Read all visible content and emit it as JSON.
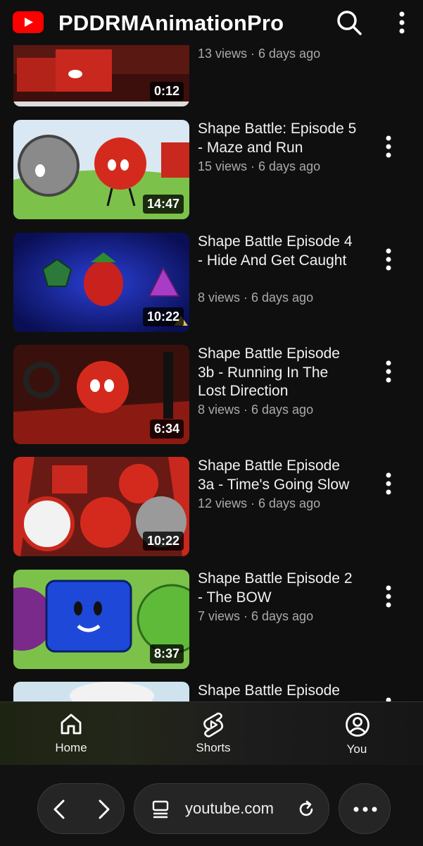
{
  "header": {
    "channel_name": "PDDRMAnimationPro",
    "logo_icon": "youtube-logo-icon",
    "search_icon": "search-icon",
    "menu_icon": "more-vertical-icon"
  },
  "videos": [
    {
      "title": "",
      "views": "13 views",
      "age": "6 days ago",
      "meta": "13 views · 6 days ago",
      "duration": "0:12"
    },
    {
      "title": "Shape Battle: Episode 5 - Maze and Run",
      "views": "15 views",
      "age": "6 days ago",
      "meta": "15 views · 6 days ago",
      "duration": "14:47"
    },
    {
      "title": "Shape Battle Episode 4 - Hide And Get Caught",
      "views": "8 views",
      "age": "6 days ago",
      "meta": "8 views · 6 days ago",
      "duration": "10:22"
    },
    {
      "title": "Shape Battle Episode 3b - Running In The Lost Direction",
      "views": "8 views",
      "age": "6 days ago",
      "meta": "8 views · 6 days ago",
      "duration": "6:34"
    },
    {
      "title": "Shape Battle Episode 3a - Time's Going Slow",
      "views": "12 views",
      "age": "6 days ago",
      "meta": "12 views · 6 days ago",
      "duration": "10:22"
    },
    {
      "title": "Shape Battle Episode 2 - The BOW",
      "views": "7 views",
      "age": "6 days ago",
      "meta": "7 views · 6 days ago",
      "duration": "8:37"
    },
    {
      "title": "Shape Battle Episode",
      "views": "",
      "age": "",
      "meta": "",
      "duration": ""
    }
  ],
  "bottom_nav": {
    "home": "Home",
    "shorts": "Shorts",
    "you": "You"
  },
  "browser": {
    "url": "youtube.com"
  },
  "colors": {
    "brand_red": "#ff0000",
    "background": "#0f0f0f",
    "meta_text": "#aaaaaa"
  }
}
